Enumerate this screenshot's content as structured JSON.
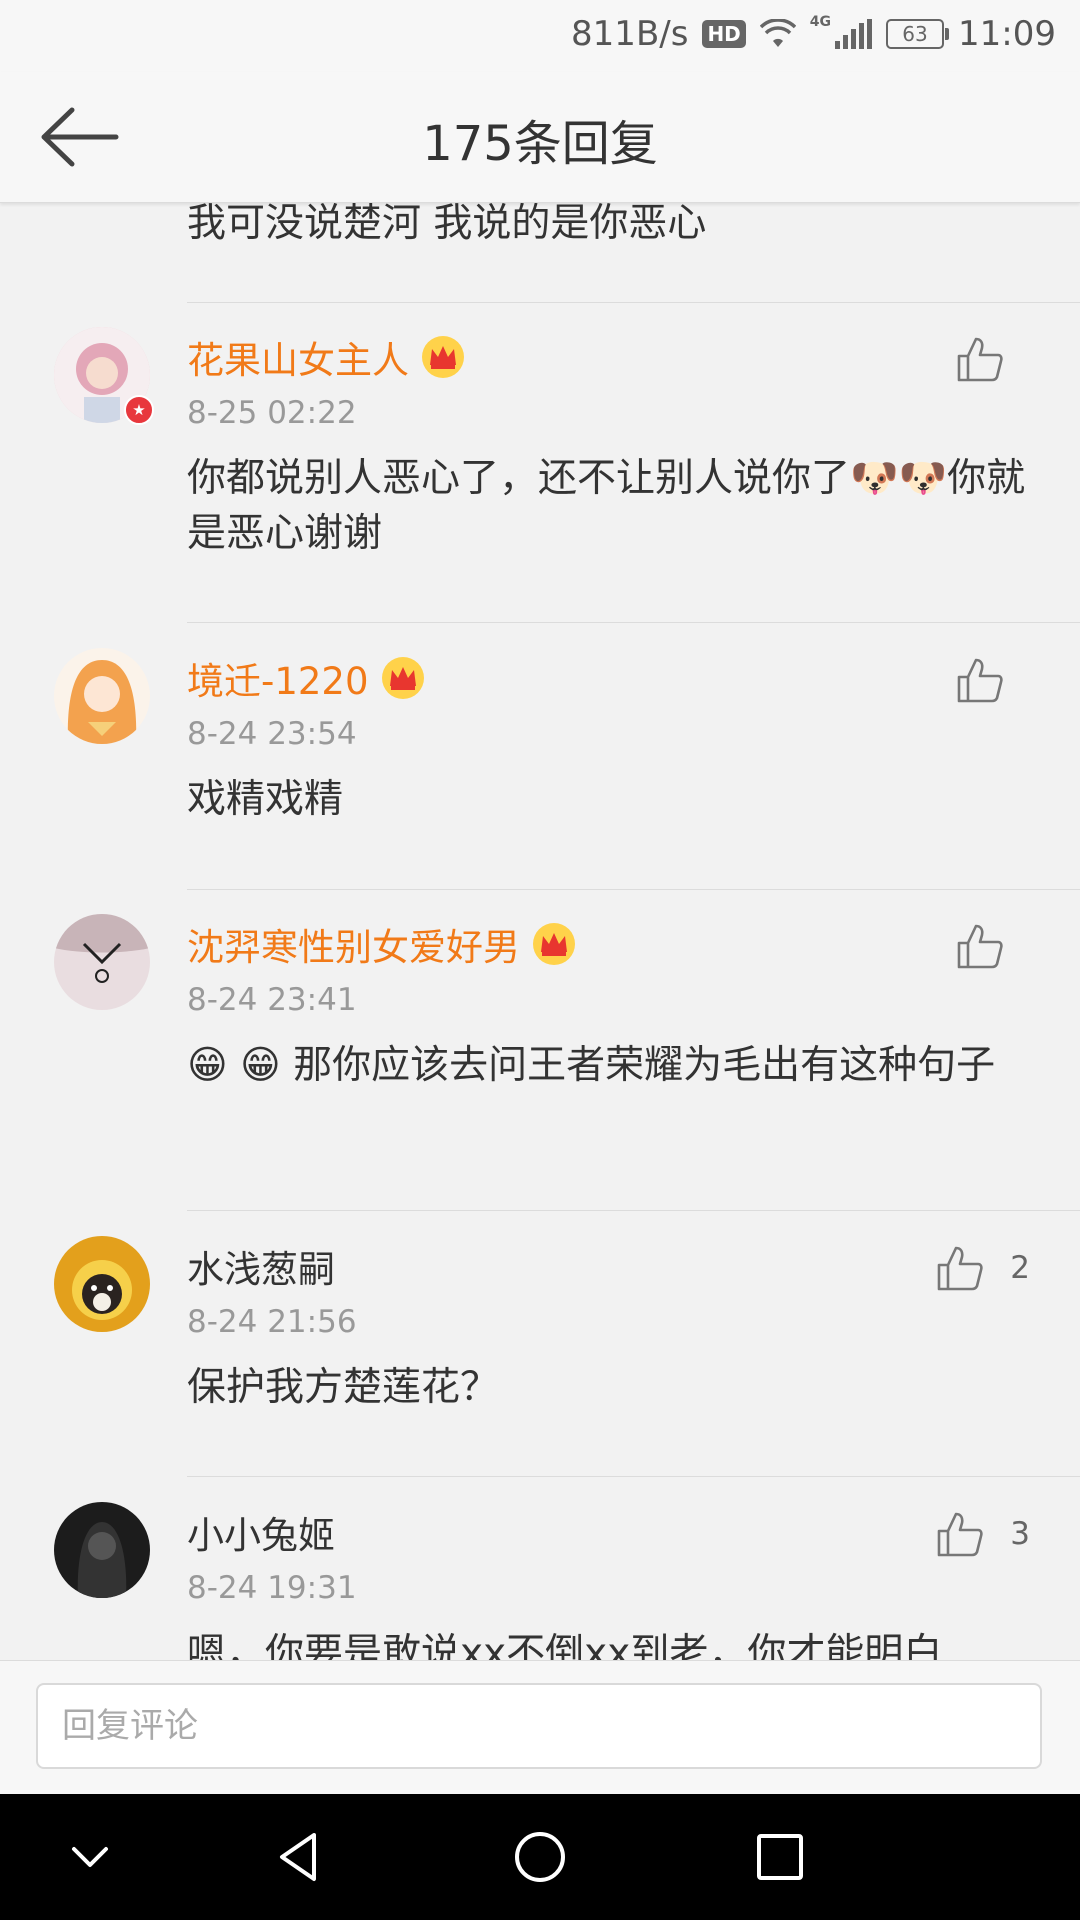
{
  "status_bar": {
    "network_speed": "811B/s",
    "hd_label": "HD",
    "lte_label": "4G",
    "battery": "63",
    "time": "11:09"
  },
  "header": {
    "title": "175条回复"
  },
  "partial_comment": {
    "text": "我可没说楚河 我说的是你恶心"
  },
  "comments": [
    {
      "username": "花果山女主人",
      "time": "8-25 02:22",
      "text": "你都说别人恶心了，还不让别人说你了🐶🐶你就是恶心谢谢",
      "likes": "",
      "vip": true,
      "verified": true,
      "avatar_color": "#f0c8d0"
    },
    {
      "username": "境迁-1220",
      "time": "8-24 23:54",
      "text": "戏精戏精",
      "likes": "",
      "vip": true,
      "verified": false,
      "avatar_color": "#f6b46a"
    },
    {
      "username": "沈羿寒性别女爱好男",
      "time": "8-24 23:41",
      "text": "😁 😁 那你应该去问王者荣耀为毛出有这种句子",
      "likes": "",
      "vip": true,
      "verified": false,
      "avatar_color": "#d8c8cc"
    },
    {
      "username": "水浅葱嗣",
      "time": "8-24 21:56",
      "text": "保护我方楚莲花？",
      "likes": "2",
      "vip": false,
      "verified": false,
      "avatar_color": "#e6a21c"
    },
    {
      "username": "小小兔姬",
      "time": "8-24 19:31",
      "text": "嗯，你要是敢说xx不倒xx到老，你才能明白",
      "likes": "3",
      "vip": false,
      "verified": false,
      "avatar_color": "#222222"
    }
  ],
  "input": {
    "placeholder": "回复评论"
  },
  "colors": {
    "vip_name": "#f17a18",
    "background": "#f2f2f2",
    "divider": "#dcdcdc"
  },
  "icons": [
    "back-arrow-icon",
    "thumbs-up-icon",
    "crown-icon",
    "verified-badge-icon",
    "collapse-icon",
    "back-triangle-icon",
    "home-circle-icon",
    "recents-square-icon"
  ]
}
